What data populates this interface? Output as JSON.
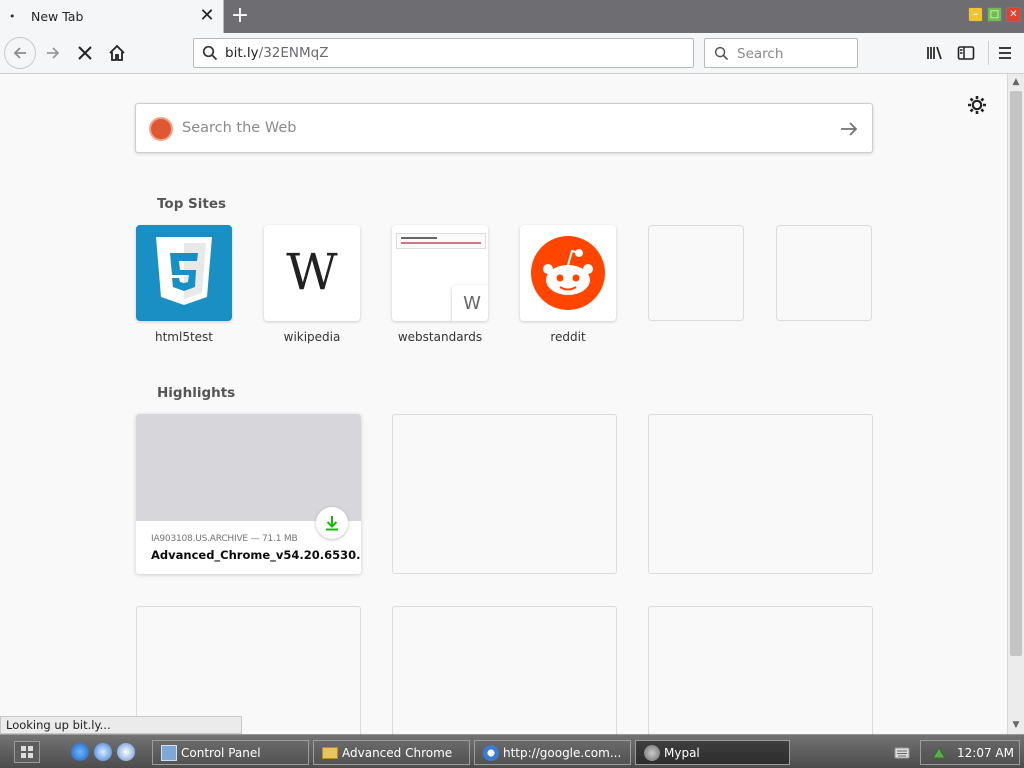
{
  "tab": {
    "title": "New Tab",
    "loading_dot": "•"
  },
  "navbar": {
    "url_host": "bit.ly",
    "url_path": "/32ENMqZ",
    "search_placeholder": "Search"
  },
  "page": {
    "websearch_placeholder": "Search the Web",
    "top_sites_title": "Top Sites",
    "top_sites": [
      {
        "label": "html5test"
      },
      {
        "label": "wikipedia",
        "glyph": "W"
      },
      {
        "label": "webstandards",
        "glyph": "W"
      },
      {
        "label": "reddit"
      }
    ],
    "highlights_title": "Highlights",
    "highlight": {
      "meta": "IA903108.US.ARCHIVE — 71.1 MB",
      "title": "Advanced_Chrome_v54.20.6530...."
    },
    "status": "Looking up bit.ly..."
  },
  "taskbar": {
    "tasks": [
      {
        "label": "Control Panel"
      },
      {
        "label": "Advanced Chrome"
      },
      {
        "label": "http://google.com..."
      },
      {
        "label": "Mypal"
      }
    ],
    "clock": "12:07 AM"
  },
  "colors": {
    "html5_bg": "#1a8fc3",
    "reddit_orange": "#ff4500",
    "download_green": "#12bc00"
  }
}
